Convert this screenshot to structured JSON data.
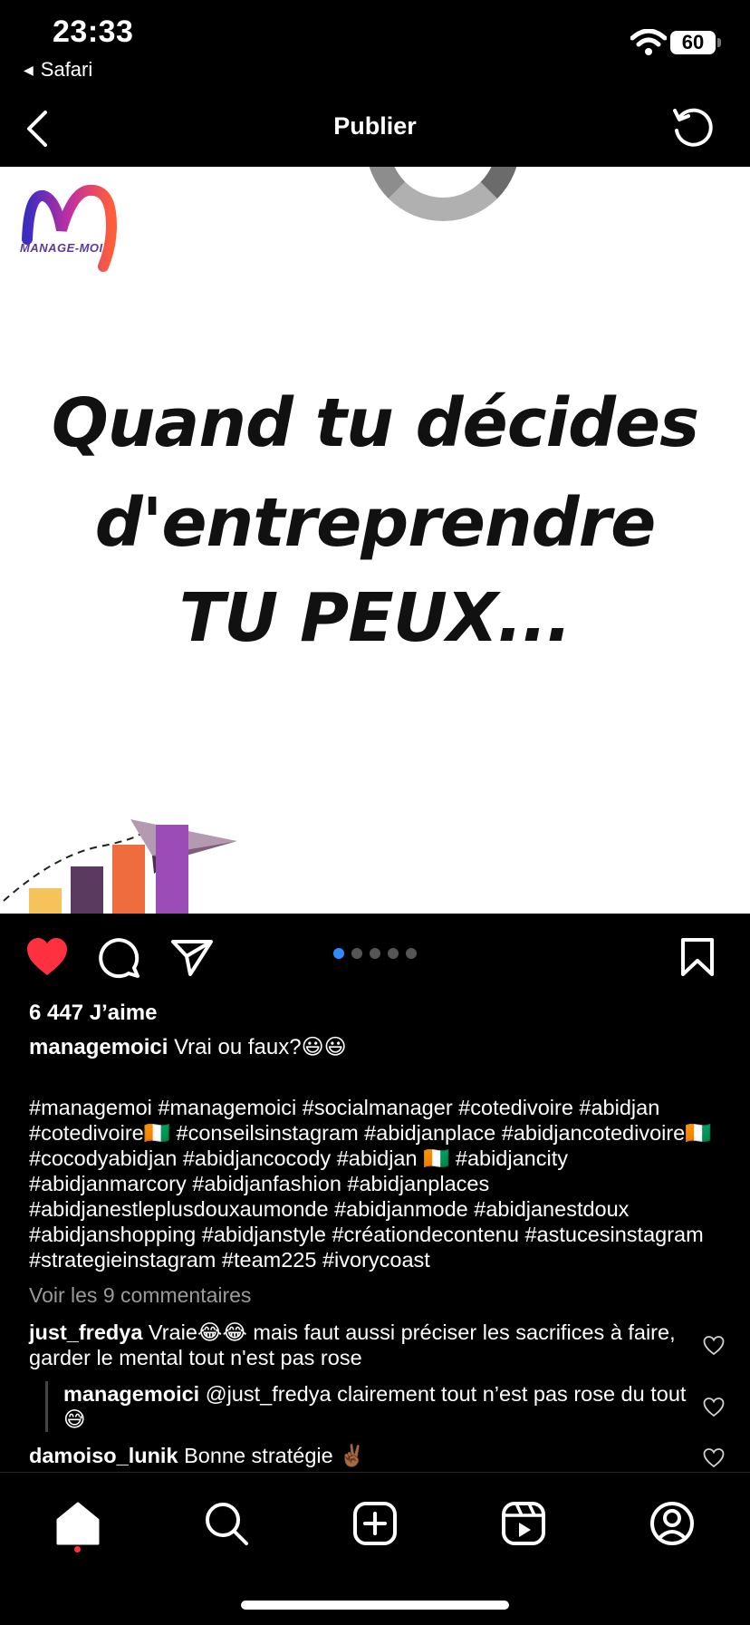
{
  "status_bar": {
    "time": "23:33",
    "back_app": "Safari",
    "battery": "60"
  },
  "header": {
    "title": "Publier"
  },
  "post": {
    "logo_text": "MANAGE-MOI",
    "headline": [
      "Quand tu décides",
      "d'entreprendre",
      "TU PEUX..."
    ]
  },
  "carousel": {
    "count": 5,
    "active": 0
  },
  "likes": "6 447 J’aime",
  "caption": {
    "username": "managemoici",
    "text": "Vrai ou faux?😃😃"
  },
  "hashtags": "#managemoi #managemoici #socialmanager #cotedivoire #abidjan #cotedivoire🇨🇮 #conseilsinstagram #abidjanplace #abidjancotedivoire🇨🇮 #cocodyabidjan #abidjancocody #abidjan 🇨🇮 #abidjancity #abidjanmarcory #abidjanfashion #abidjanplaces #abidjanestleplusdouxaumonde #abidjanmode #abidjanestdoux #abidjanshopping #abidjanstyle #créationdecontenu #astucesinstagram #strategieinstagram #team225 #ivorycoast",
  "view_comments": "Voir les 9 commentaires",
  "comments": [
    {
      "username": "just_fredya",
      "text": "Vraie😂😂 mais faut aussi préciser les sacrifices à faire, garder le mental tout n'est pas rose"
    },
    {
      "username": "managemoici",
      "text": "@just_fredya clairement tout n’est pas rose du tout😅"
    },
    {
      "username": "damoiso_lunik",
      "text": "Bonne stratégie ✌🏾"
    }
  ],
  "colors": {
    "like_red": "#ff3040",
    "active_dot": "#2f8cff"
  }
}
